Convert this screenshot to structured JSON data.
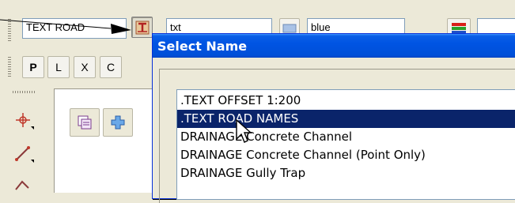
{
  "toolbar": {
    "name_value": "TEXT ROAD",
    "style_value": "txt",
    "colour_value": "blue"
  },
  "mode_buttons": [
    {
      "label": "P"
    },
    {
      "label": "L"
    },
    {
      "label": "X"
    },
    {
      "label": "C"
    }
  ],
  "dialog": {
    "title": "Select Name",
    "list": [
      {
        "label": ".TEXT OFFSET 1:200",
        "selected": false
      },
      {
        "label": ".TEXT ROAD NAMES",
        "selected": true
      },
      {
        "label": "DRAINAGE Concrete Channel",
        "selected": false
      },
      {
        "label": "DRAINAGE Concrete Channel (Point Only)",
        "selected": false
      },
      {
        "label": "DRAINAGE Gully Trap",
        "selected": false
      }
    ]
  },
  "colors": {
    "titlebar": "#0054e3",
    "selection": "#0a246a"
  }
}
